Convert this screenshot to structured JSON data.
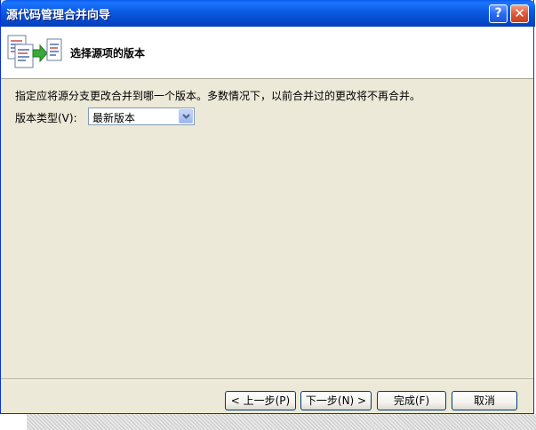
{
  "window": {
    "title": "源代码管理合并向导",
    "help_label": "?",
    "close_label": "✕"
  },
  "header": {
    "title": "选择源项的版本",
    "icon": "merge-documents-icon"
  },
  "body": {
    "description": "指定应将源分支更改合并到哪一个版本。多数情况下，以前合并过的更改将不再合并。",
    "version_type_label": "版本类型(V):",
    "version_type_value": "最新版本"
  },
  "buttons": {
    "back": "< 上一步(P)",
    "next": "下一步(N) >",
    "finish": "完成(F)",
    "cancel": "取消"
  },
  "colors": {
    "titlebar": "#0a5ae8",
    "dialog_bg": "#ece9d8",
    "header_bg": "#ffffff",
    "close_button": "#e0583a"
  }
}
